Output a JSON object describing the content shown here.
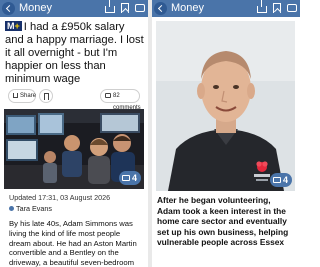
{
  "left": {
    "topbar": {
      "section": "Money"
    },
    "headline": {
      "logo_main": "M",
      "logo_plus": "+",
      "text": "I had a £950k salary and a happy marriage. I lost it all overnight - but I'm happier on less than minimum wage"
    },
    "actions": {
      "share_label": "Share",
      "comments_label": "82 comments"
    },
    "photo": {
      "gallery_count": "4"
    },
    "meta": {
      "updated": "Updated 17:31, 03 August 2026",
      "author": "Tara Evans"
    },
    "body": "By his late 40s, Adam Simmons was living the kind of life most people dream about. He had an Aston Martin convertible and a Bentley on the driveway, a beautiful seven-bedroom home in Loughton, Essex, and"
  },
  "right": {
    "topbar": {
      "section": "Money"
    },
    "photo": {
      "gallery_count": "4"
    },
    "caption": "After he began volunteering, Adam took a keen interest in the home care sector and eventually set up his own business, helping vulnerable people across Essex"
  },
  "colors": {
    "brand_blue": "#4a74a9",
    "logo_navy": "#17306a",
    "logo_yellow": "#ffd400"
  },
  "icons": [
    "back-arrow-icon",
    "share-icon",
    "bookmark-icon",
    "comment-icon",
    "gallery-icon",
    "person-icon"
  ]
}
